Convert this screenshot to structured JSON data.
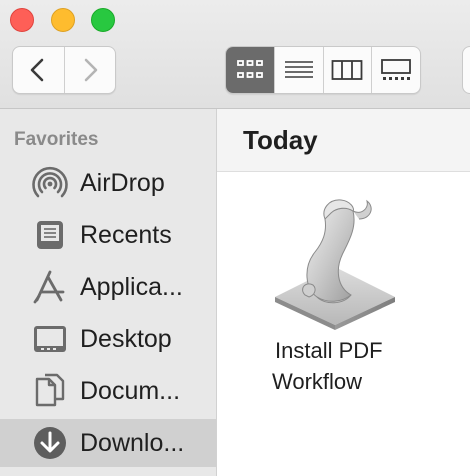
{
  "window": {
    "controls": [
      "close",
      "minimize",
      "zoom"
    ]
  },
  "toolbar": {
    "nav": [
      {
        "name": "back",
        "icon": "chevron-left-icon",
        "enabled": true
      },
      {
        "name": "forward",
        "icon": "chevron-right-icon",
        "enabled": false
      }
    ],
    "views": [
      {
        "name": "icon-view",
        "icon": "grid-icon",
        "active": true
      },
      {
        "name": "list-view",
        "icon": "list-icon",
        "active": false
      },
      {
        "name": "column-view",
        "icon": "columns-icon",
        "active": false
      },
      {
        "name": "gallery-view",
        "icon": "gallery-icon",
        "active": false
      }
    ],
    "active_color": "#6b6b6b"
  },
  "sidebar": {
    "heading": "Favorites",
    "items": [
      {
        "label": "AirDrop",
        "icon": "airdrop-icon",
        "selected": false
      },
      {
        "label": "Recents",
        "icon": "recents-icon",
        "selected": false
      },
      {
        "label": "Applica...",
        "icon": "applications-icon",
        "selected": false
      },
      {
        "label": "Desktop",
        "icon": "desktop-icon",
        "selected": false
      },
      {
        "label": "Docum...",
        "icon": "documents-icon",
        "selected": false
      },
      {
        "label": "Downlo...",
        "icon": "downloads-icon",
        "selected": true
      }
    ]
  },
  "main": {
    "section_title": "Today",
    "files": [
      {
        "name_line1": "Install PDF",
        "name_line2": "Workflow",
        "icon": "workflow-scroll-icon"
      }
    ]
  }
}
